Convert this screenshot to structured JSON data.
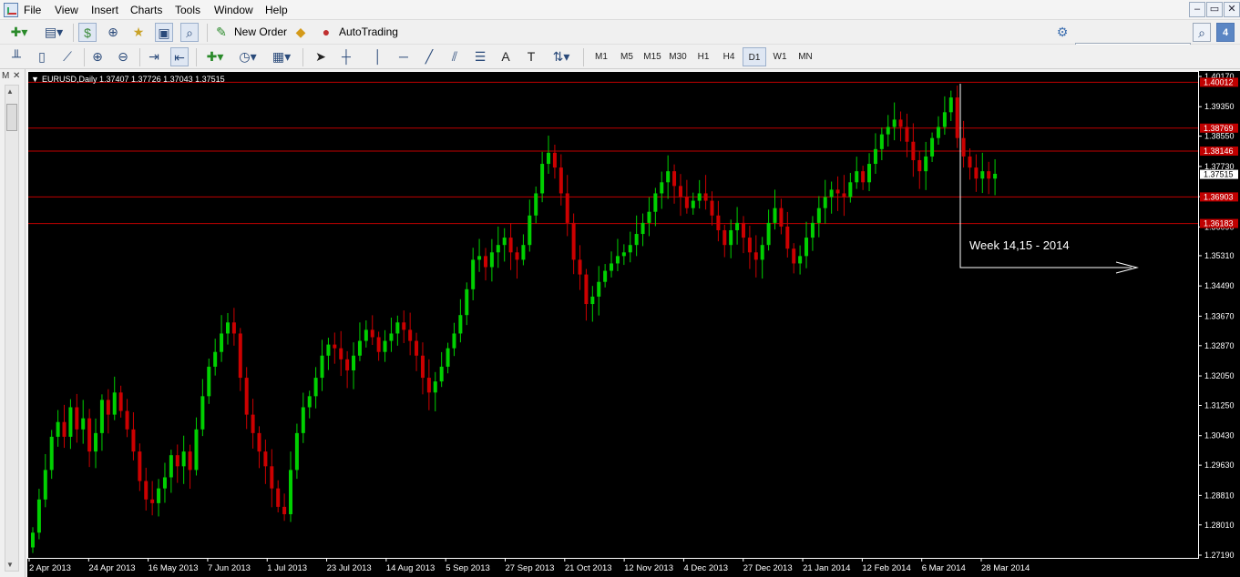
{
  "menu": {
    "items": [
      "File",
      "View",
      "Insert",
      "Charts",
      "Tools",
      "Window",
      "Help"
    ],
    "window_buttons": [
      "–",
      "▭",
      "✕"
    ]
  },
  "toolbar": {
    "new_order": "New Order",
    "autotrading": "AutoTrading",
    "periods": [
      "M1",
      "M5",
      "M15",
      "M30",
      "H1",
      "H4",
      "D1",
      "W1",
      "MN"
    ],
    "active_period": "D1",
    "search_value": "",
    "search_badge": "4"
  },
  "side": {
    "tab": "M",
    "close": "✕"
  },
  "colors": {
    "chart_bg": "#000000",
    "bull": "#00d000",
    "bear": "#cc0000",
    "line": "#c00000",
    "label_fill": "#c00000",
    "axis_text": "#ffffff"
  },
  "chart_data": {
    "type": "candlestick",
    "symbol_line": "EURUSD,Daily  1.37407 1.37726 1.37043 1.37515",
    "current_price": "1.37515",
    "price_ticks": [
      "1.40170",
      "1.39350",
      "1.38550",
      "1.37730",
      "1.36910",
      "1.36090",
      "1.35310",
      "1.34490",
      "1.33670",
      "1.32870",
      "1.32050",
      "1.31250",
      "1.30430",
      "1.29630",
      "1.28810",
      "1.28010",
      "1.27190"
    ],
    "date_ticks": [
      "2 Apr 2013",
      "24 Apr 2013",
      "16 May 2013",
      "7 Jun 2013",
      "1 Jul 2013",
      "23 Jul 2013",
      "14 Aug 2013",
      "5 Sep 2013",
      "27 Sep 2013",
      "21 Oct 2013",
      "12 Nov 2013",
      "4 Dec 2013",
      "27 Dec 2013",
      "21 Jan 2014",
      "12 Feb 2014",
      "6 Mar 2014",
      "28 Mar 2014"
    ],
    "horizontal_levels": [
      {
        "price": 1.40012,
        "label": "1.40012"
      },
      {
        "price": 1.38769,
        "label": "1.38769"
      },
      {
        "price": 1.38146,
        "label": "1.38146"
      },
      {
        "price": 1.36903,
        "label": "1.36903"
      },
      {
        "price": 1.36183,
        "label": "1.36183"
      }
    ],
    "annotation": "Week 14,15 - 2014",
    "closes": [
      1.278,
      1.287,
      1.295,
      1.304,
      1.308,
      1.304,
      1.312,
      1.306,
      1.309,
      1.3,
      1.305,
      1.314,
      1.31,
      1.316,
      1.311,
      1.306,
      1.3,
      1.292,
      1.287,
      1.286,
      1.29,
      1.293,
      1.299,
      1.296,
      1.3,
      1.295,
      1.306,
      1.315,
      1.323,
      1.327,
      1.332,
      1.335,
      1.332,
      1.32,
      1.31,
      1.305,
      1.3,
      1.296,
      1.29,
      1.285,
      1.283,
      1.295,
      1.305,
      1.312,
      1.315,
      1.32,
      1.326,
      1.329,
      1.328,
      1.325,
      1.322,
      1.326,
      1.33,
      1.333,
      1.331,
      1.327,
      1.33,
      1.332,
      1.335,
      1.333,
      1.33,
      1.326,
      1.32,
      1.316,
      1.319,
      1.323,
      1.328,
      1.332,
      1.337,
      1.344,
      1.352,
      1.353,
      1.35,
      1.354,
      1.356,
      1.358,
      1.354,
      1.352,
      1.356,
      1.364,
      1.37,
      1.378,
      1.381,
      1.377,
      1.37,
      1.362,
      1.352,
      1.348,
      1.34,
      1.342,
      1.346,
      1.349,
      1.351,
      1.353,
      1.354,
      1.356,
      1.359,
      1.362,
      1.365,
      1.37,
      1.373,
      1.376,
      1.372,
      1.369,
      1.366,
      1.368,
      1.37,
      1.368,
      1.364,
      1.36,
      1.356,
      1.36,
      1.362,
      1.358,
      1.354,
      1.352,
      1.356,
      1.362,
      1.366,
      1.361,
      1.355,
      1.351,
      1.353,
      1.358,
      1.362,
      1.366,
      1.369,
      1.371,
      1.37,
      1.369,
      1.373,
      1.376,
      1.373,
      1.378,
      1.382,
      1.386,
      1.388,
      1.39,
      1.388,
      1.384,
      1.379,
      1.376,
      1.38,
      1.385,
      1.388,
      1.392,
      1.396,
      1.385,
      1.38,
      1.377,
      1.374,
      1.376,
      1.374,
      1.3753
    ]
  }
}
